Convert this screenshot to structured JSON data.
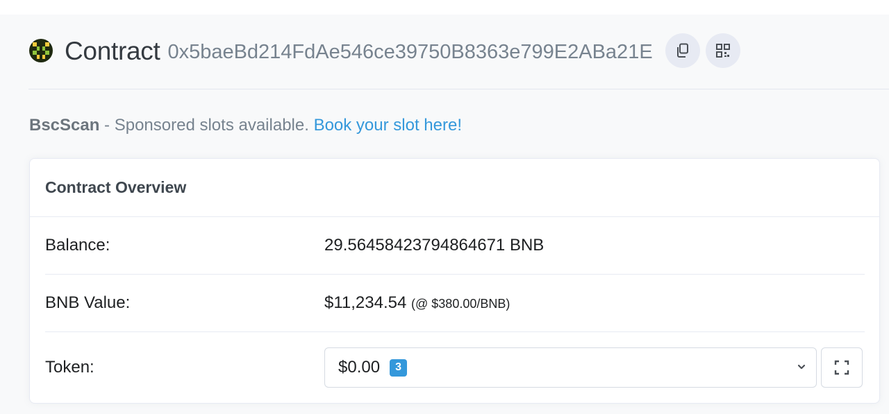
{
  "header": {
    "title": "Contract",
    "address": "0x5baeBd214FdAe546ce39750B8363e799E2ABa21E",
    "copy_icon": "copy-icon",
    "qr_icon": "qr-code-icon"
  },
  "sponsor": {
    "brand": "BscScan",
    "text": " - Sponsored slots available. ",
    "link": "Book your slot here!"
  },
  "overview": {
    "title": "Contract Overview",
    "balance_label": "Balance:",
    "balance_value": "29.56458423794864671 BNB",
    "bnb_value_label": "BNB Value:",
    "bnb_value": "$11,234.54",
    "bnb_rate": "(@ $380.00/BNB)",
    "token_label": "Token:",
    "token_value": "$0.00",
    "token_count": "3"
  },
  "colors": {
    "accent": "#3498db",
    "background": "#f8f9fa"
  }
}
